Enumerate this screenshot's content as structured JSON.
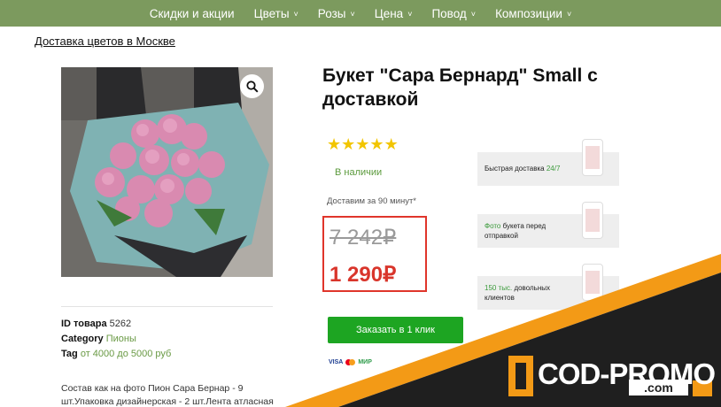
{
  "nav": {
    "items": [
      {
        "label": "Скидки и акции",
        "has_dropdown": false
      },
      {
        "label": "Цветы",
        "has_dropdown": true
      },
      {
        "label": "Розы",
        "has_dropdown": true
      },
      {
        "label": "Цена",
        "has_dropdown": true
      },
      {
        "label": "Повод",
        "has_dropdown": true
      },
      {
        "label": "Композиции",
        "has_dropdown": true
      }
    ]
  },
  "breadcrumb": "Доставка цветов в Москве",
  "product": {
    "title": "Букет \"Сара Бернард\" Small с доставкой",
    "rating": 5,
    "stock_status": "В наличии",
    "delivery_time": "Доставим за 90 минут*",
    "old_price": "7 242₽",
    "new_price": "1 290₽",
    "order_button": "Заказать в 1 клик"
  },
  "payment_methods": [
    "VISA",
    "MasterCard",
    "МИР"
  ],
  "meta": {
    "id_label": "ID товара",
    "id_value": "5262",
    "category_label": "Category",
    "category_value": "Пионы",
    "tag_label": "Tag",
    "tag_value": "от 4000 до 5000 руб"
  },
  "description": "Состав как на фото Пион Сара Бернар - 9 шт.Упаковка дизайнерская - 2 шт.Лента атласная -",
  "info_cards": [
    {
      "text": "Быстрая доставка ",
      "highlight": "24/7",
      "highlight_first": false
    },
    {
      "text": " букета перед отправкой",
      "highlight": "Фото",
      "highlight_first": true
    },
    {
      "text": " довольных клиентов",
      "highlight": "150 тыс.",
      "highlight_first": true
    }
  ],
  "promo": {
    "brand": "COD-PROMO",
    "domain": ".com"
  },
  "colors": {
    "nav_bg": "#7c9a5e",
    "accent_green": "#1da522",
    "price_red": "#d9352b",
    "promo_orange": "#f39a16"
  }
}
